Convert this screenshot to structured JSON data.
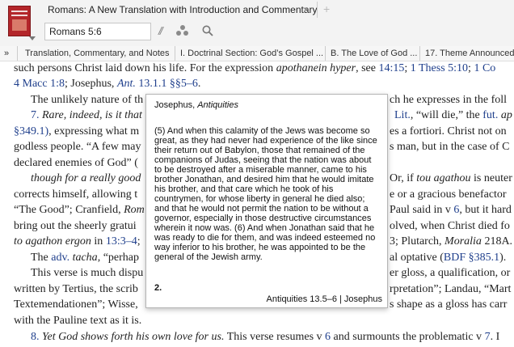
{
  "tab": {
    "title": "Romans: A New Translation with Introduction and Commentary",
    "close_glyph": "×",
    "add_glyph": "+"
  },
  "toolbar": {
    "reference_value": "Romans 5:6",
    "parallel_glyph": "//"
  },
  "breadcrumb": {
    "collapse_glyph": "»",
    "items": [
      "Translation, Commentary, and Notes",
      "I. Doctrinal Section: God’s Gospel ...",
      "B. The Love of God ...",
      "17. Theme Announced"
    ]
  },
  "content": {
    "l1_a": "such persons Christ laid down his life. For the expression ",
    "l1_b": "apothanein hyper",
    "l1_c": ", see ",
    "l1_d": "14:15",
    "l1_e": "; ",
    "l1_f": "1 Thess 5:10",
    "l1_g": "; ",
    "l1_h": "1 Co",
    "l2_a": "4 Macc 1:8",
    "l2_b": "; Josephus, ",
    "l2_c": "Ant.",
    "l2_d": " 13.1.1 §§5–6",
    "l2_e": ".",
    "l3_a": "The unlikely nature of th",
    "l3_b": "ch he expresses in the foll",
    "l4_a": "7. ",
    "l4_b": "Rare, indeed, is it that",
    "l4_c": "Lit.",
    "l4_d": ", “will die,” the ",
    "l4_e": "fut.",
    "l4_f": " ap",
    "l5_a": "§349.1)",
    "l5_b": ", expressing what m",
    "l5_c": "es a fortiori. Christ not on",
    "l6_a": "godless people. “A few may",
    "l6_b": "s man, but in the case of C",
    "l7_a": "declared enemies of God” (",
    "l8_a": "though for a really good",
    "l8_b": "Or, if ",
    "l8_c": "tou agathou",
    "l8_d": " is neuter",
    "l9_a": "corrects himself, allowing t",
    "l9_b": "e or a gracious benefactor",
    "l10_a": "“The Good”; Cranfield, ",
    "l10_b": "Rom",
    "l10_c": "Paul said in v ",
    "l10_d": "6",
    "l10_e": ", but it hard",
    "l11_a": "bring out the sheerly gratui",
    "l11_b": "olved, when Christ died fo",
    "l12_a": "to agathon ergon",
    "l12_b": " in ",
    "l12_c": "13:3–4",
    "l12_d": ";",
    "l12_e": "3",
    "l12_f": "; Plutarch, ",
    "l12_g": "Moralia",
    "l12_h": " 218A.",
    "l13_a": "The ",
    "l13_b": "adv.",
    "l13_c": " ",
    "l13_d": "tacha",
    "l13_e": ", “perhap",
    "l13_f": "al optative (",
    "l13_g": "BDF §385.1",
    "l13_h": ").",
    "l14_a": "This verse is much dispu",
    "l14_b": "er gloss, a qualification, or",
    "l15_a": "written by Tertius, the scrib",
    "l15_b": "rpretation”; Landau, “Mart",
    "l16_a": "Textemendationen”; Wisse,",
    "l16_b": "s shape as a gloss has carr",
    "l17_a": "with the Pauline text as it is.",
    "l18_a": "8. ",
    "l18_b": "Yet God shows forth his own love for us.",
    "l18_c": " This verse resumes v ",
    "l18_d": "6",
    "l18_e": " and surmounts the problematic v ",
    "l18_f": "7",
    "l18_g": ". I"
  },
  "popup": {
    "title_author": "Josephus, ",
    "title_work": "Antiquities",
    "body_lines": [
      "(5) And when this calamity of the Jews was become so",
      "great, as they had never had experience of the like since",
      "their return out of Babylon, those that remained of the",
      "companions of Judas, seeing that the nation was about",
      "to be destroyed after a miserable manner, came to his",
      "brother Jonathan, and desired him that he would imitate",
      "his brother, and that care which he took of his",
      "countrymen, for whose liberty in general he died also;",
      "and that he would not permit the nation to be without a",
      "governor, especially in those destructive circumstances",
      "wherein it now was. (6) And when Jonathan said that he",
      "was ready to die for them, and was indeed esteemed no",
      "way inferior to his brother, he was appointed to be the",
      "general of the Jewish army."
    ],
    "section_number": "2.",
    "footer": "Antiquities 13.5–6 | Josephus"
  }
}
